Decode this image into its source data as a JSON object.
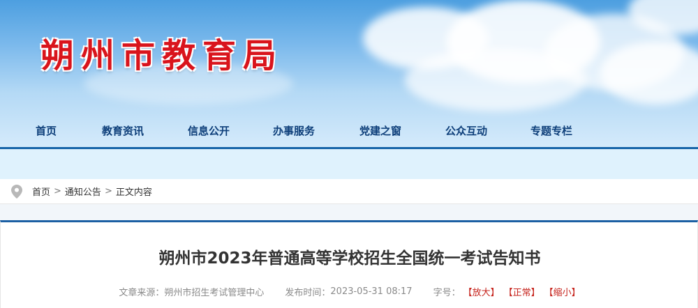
{
  "site": {
    "title": "朔州市教育局"
  },
  "nav": {
    "items": [
      {
        "label": "首页"
      },
      {
        "label": "教育资讯"
      },
      {
        "label": "信息公开"
      },
      {
        "label": "办事服务"
      },
      {
        "label": "党建之窗"
      },
      {
        "label": "公众互动"
      },
      {
        "label": "专题专栏"
      }
    ]
  },
  "breadcrumb": {
    "icon": "location-pin-icon",
    "items": [
      "首页",
      "通知公告",
      "正文内容"
    ],
    "separator": ">"
  },
  "article": {
    "title": "朔州市2023年普通高等学校招生全国统一考试告知书",
    "source_label": "文章来源：",
    "source": "朔州市招生考试管理中心",
    "date_label": "发布时间：",
    "date": "2023-05-31 08:17",
    "font_size_label": "字号：",
    "size_large": "【放大】",
    "size_normal": "【正常】",
    "size_small": "【缩小】"
  },
  "colors": {
    "title_red": "#d9141c",
    "nav_text": "#0e3f7a",
    "nav_rule": "#1764a8",
    "size_button": "#c6231c"
  }
}
